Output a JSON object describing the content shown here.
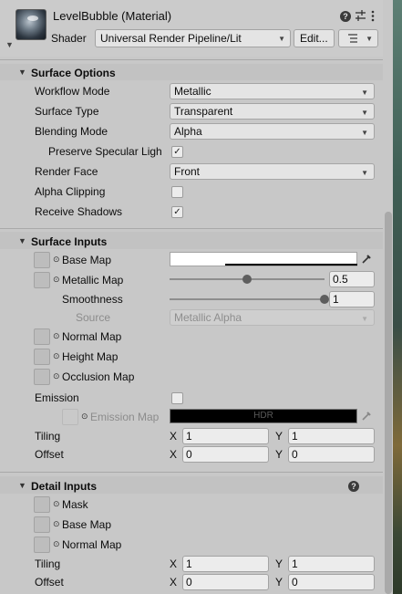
{
  "header": {
    "title": "LevelBubble (Material)",
    "shader_label": "Shader",
    "shader_value": "Universal Render Pipeline/Lit",
    "edit_label": "Edit...",
    "help_icon": "question-circle-icon",
    "settings_icon": "sliders-icon",
    "more_icon": "kebab-menu-icon"
  },
  "surface_options": {
    "title": "Surface Options",
    "workflow_mode": {
      "label": "Workflow Mode",
      "value": "Metallic"
    },
    "surface_type": {
      "label": "Surface Type",
      "value": "Transparent"
    },
    "blending_mode": {
      "label": "Blending Mode",
      "value": "Alpha"
    },
    "preserve_specular": {
      "label": "Preserve Specular Ligh",
      "checked": true
    },
    "render_face": {
      "label": "Render Face",
      "value": "Front"
    },
    "alpha_clipping": {
      "label": "Alpha Clipping",
      "checked": false
    },
    "receive_shadows": {
      "label": "Receive Shadows",
      "checked": true
    }
  },
  "surface_inputs": {
    "title": "Surface Inputs",
    "base_map": {
      "label": "Base Map",
      "color": "#ffffff"
    },
    "metallic_map": {
      "label": "Metallic Map",
      "value": "0.5",
      "slider": 0.5
    },
    "smoothness": {
      "label": "Smoothness",
      "value": "1",
      "slider": 1.0
    },
    "source": {
      "label": "Source",
      "value": "Metallic Alpha"
    },
    "normal_map": {
      "label": "Normal Map"
    },
    "height_map": {
      "label": "Height Map"
    },
    "occlusion_map": {
      "label": "Occlusion Map"
    },
    "emission": {
      "label": "Emission",
      "checked": false
    },
    "emission_map": {
      "label": "Emission Map",
      "hdr_label": "HDR",
      "color": "#000000"
    },
    "tiling": {
      "label": "Tiling",
      "x_label": "X",
      "x": "1",
      "y_label": "Y",
      "y": "1"
    },
    "offset": {
      "label": "Offset",
      "x_label": "X",
      "x": "0",
      "y_label": "Y",
      "y": "0"
    }
  },
  "detail_inputs": {
    "title": "Detail Inputs",
    "mask": {
      "label": "Mask"
    },
    "base_map": {
      "label": "Base Map"
    },
    "normal_map": {
      "label": "Normal Map"
    },
    "tiling": {
      "label": "Tiling",
      "x_label": "X",
      "x": "1",
      "y_label": "Y",
      "y": "1"
    },
    "offset": {
      "label": "Offset",
      "x_label": "X",
      "x": "0",
      "y_label": "Y",
      "y": "0"
    }
  },
  "glyphs": {
    "check": "✓",
    "arrow_down": "▼",
    "circle": "⊙",
    "help": "?",
    "eyedropper": "✎"
  }
}
